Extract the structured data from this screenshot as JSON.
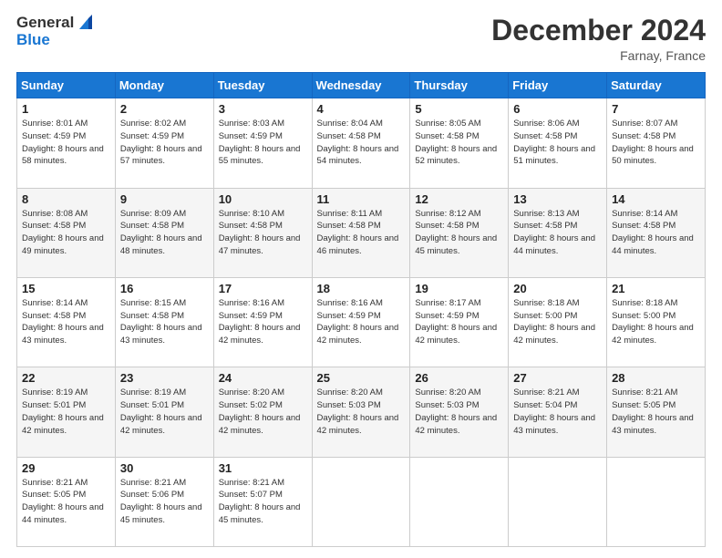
{
  "header": {
    "logo_general": "General",
    "logo_blue": "Blue",
    "month_title": "December 2024",
    "location": "Farnay, France"
  },
  "days_of_week": [
    "Sunday",
    "Monday",
    "Tuesday",
    "Wednesday",
    "Thursday",
    "Friday",
    "Saturday"
  ],
  "weeks": [
    [
      {
        "day": 1,
        "sunrise": "8:01 AM",
        "sunset": "4:59 PM",
        "daylight": "8 hours and 58 minutes."
      },
      {
        "day": 2,
        "sunrise": "8:02 AM",
        "sunset": "4:59 PM",
        "daylight": "8 hours and 57 minutes."
      },
      {
        "day": 3,
        "sunrise": "8:03 AM",
        "sunset": "4:59 PM",
        "daylight": "8 hours and 55 minutes."
      },
      {
        "day": 4,
        "sunrise": "8:04 AM",
        "sunset": "4:58 PM",
        "daylight": "8 hours and 54 minutes."
      },
      {
        "day": 5,
        "sunrise": "8:05 AM",
        "sunset": "4:58 PM",
        "daylight": "8 hours and 52 minutes."
      },
      {
        "day": 6,
        "sunrise": "8:06 AM",
        "sunset": "4:58 PM",
        "daylight": "8 hours and 51 minutes."
      },
      {
        "day": 7,
        "sunrise": "8:07 AM",
        "sunset": "4:58 PM",
        "daylight": "8 hours and 50 minutes."
      }
    ],
    [
      {
        "day": 8,
        "sunrise": "8:08 AM",
        "sunset": "4:58 PM",
        "daylight": "8 hours and 49 minutes."
      },
      {
        "day": 9,
        "sunrise": "8:09 AM",
        "sunset": "4:58 PM",
        "daylight": "8 hours and 48 minutes."
      },
      {
        "day": 10,
        "sunrise": "8:10 AM",
        "sunset": "4:58 PM",
        "daylight": "8 hours and 47 minutes."
      },
      {
        "day": 11,
        "sunrise": "8:11 AM",
        "sunset": "4:58 PM",
        "daylight": "8 hours and 46 minutes."
      },
      {
        "day": 12,
        "sunrise": "8:12 AM",
        "sunset": "4:58 PM",
        "daylight": "8 hours and 45 minutes."
      },
      {
        "day": 13,
        "sunrise": "8:13 AM",
        "sunset": "4:58 PM",
        "daylight": "8 hours and 44 minutes."
      },
      {
        "day": 14,
        "sunrise": "8:14 AM",
        "sunset": "4:58 PM",
        "daylight": "8 hours and 44 minutes."
      }
    ],
    [
      {
        "day": 15,
        "sunrise": "8:14 AM",
        "sunset": "4:58 PM",
        "daylight": "8 hours and 43 minutes."
      },
      {
        "day": 16,
        "sunrise": "8:15 AM",
        "sunset": "4:58 PM",
        "daylight": "8 hours and 43 minutes."
      },
      {
        "day": 17,
        "sunrise": "8:16 AM",
        "sunset": "4:59 PM",
        "daylight": "8 hours and 42 minutes."
      },
      {
        "day": 18,
        "sunrise": "8:16 AM",
        "sunset": "4:59 PM",
        "daylight": "8 hours and 42 minutes."
      },
      {
        "day": 19,
        "sunrise": "8:17 AM",
        "sunset": "4:59 PM",
        "daylight": "8 hours and 42 minutes."
      },
      {
        "day": 20,
        "sunrise": "8:18 AM",
        "sunset": "5:00 PM",
        "daylight": "8 hours and 42 minutes."
      },
      {
        "day": 21,
        "sunrise": "8:18 AM",
        "sunset": "5:00 PM",
        "daylight": "8 hours and 42 minutes."
      }
    ],
    [
      {
        "day": 22,
        "sunrise": "8:19 AM",
        "sunset": "5:01 PM",
        "daylight": "8 hours and 42 minutes."
      },
      {
        "day": 23,
        "sunrise": "8:19 AM",
        "sunset": "5:01 PM",
        "daylight": "8 hours and 42 minutes."
      },
      {
        "day": 24,
        "sunrise": "8:20 AM",
        "sunset": "5:02 PM",
        "daylight": "8 hours and 42 minutes."
      },
      {
        "day": 25,
        "sunrise": "8:20 AM",
        "sunset": "5:03 PM",
        "daylight": "8 hours and 42 minutes."
      },
      {
        "day": 26,
        "sunrise": "8:20 AM",
        "sunset": "5:03 PM",
        "daylight": "8 hours and 42 minutes."
      },
      {
        "day": 27,
        "sunrise": "8:21 AM",
        "sunset": "5:04 PM",
        "daylight": "8 hours and 43 minutes."
      },
      {
        "day": 28,
        "sunrise": "8:21 AM",
        "sunset": "5:05 PM",
        "daylight": "8 hours and 43 minutes."
      }
    ],
    [
      {
        "day": 29,
        "sunrise": "8:21 AM",
        "sunset": "5:05 PM",
        "daylight": "8 hours and 44 minutes."
      },
      {
        "day": 30,
        "sunrise": "8:21 AM",
        "sunset": "5:06 PM",
        "daylight": "8 hours and 45 minutes."
      },
      {
        "day": 31,
        "sunrise": "8:21 AM",
        "sunset": "5:07 PM",
        "daylight": "8 hours and 45 minutes."
      },
      null,
      null,
      null,
      null
    ]
  ]
}
